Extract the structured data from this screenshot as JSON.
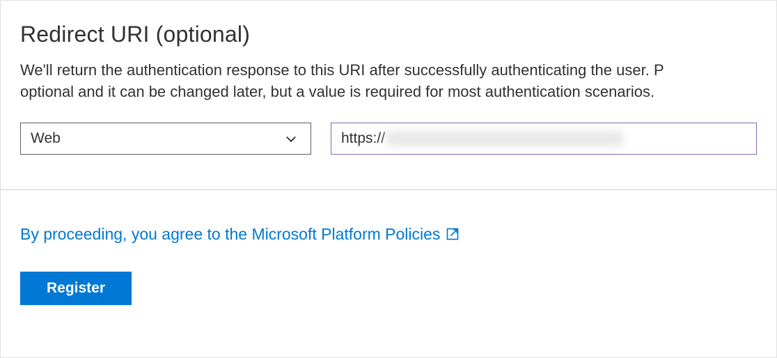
{
  "section": {
    "title": "Redirect URI (optional)",
    "description_line1": "We'll return the authentication response to this URI after successfully authenticating the user. P",
    "description_line2": "optional and it can be changed later, but a value is required for most authentication scenarios."
  },
  "platform_dropdown": {
    "selected": "Web"
  },
  "url_input": {
    "prefix": "https://"
  },
  "policies": {
    "text": "By proceeding, you agree to the Microsoft Platform Policies"
  },
  "buttons": {
    "register": "Register"
  },
  "colors": {
    "primary": "#0078d4",
    "focus_border": "#8764b8",
    "text": "#323130",
    "border": "#605e5c"
  }
}
